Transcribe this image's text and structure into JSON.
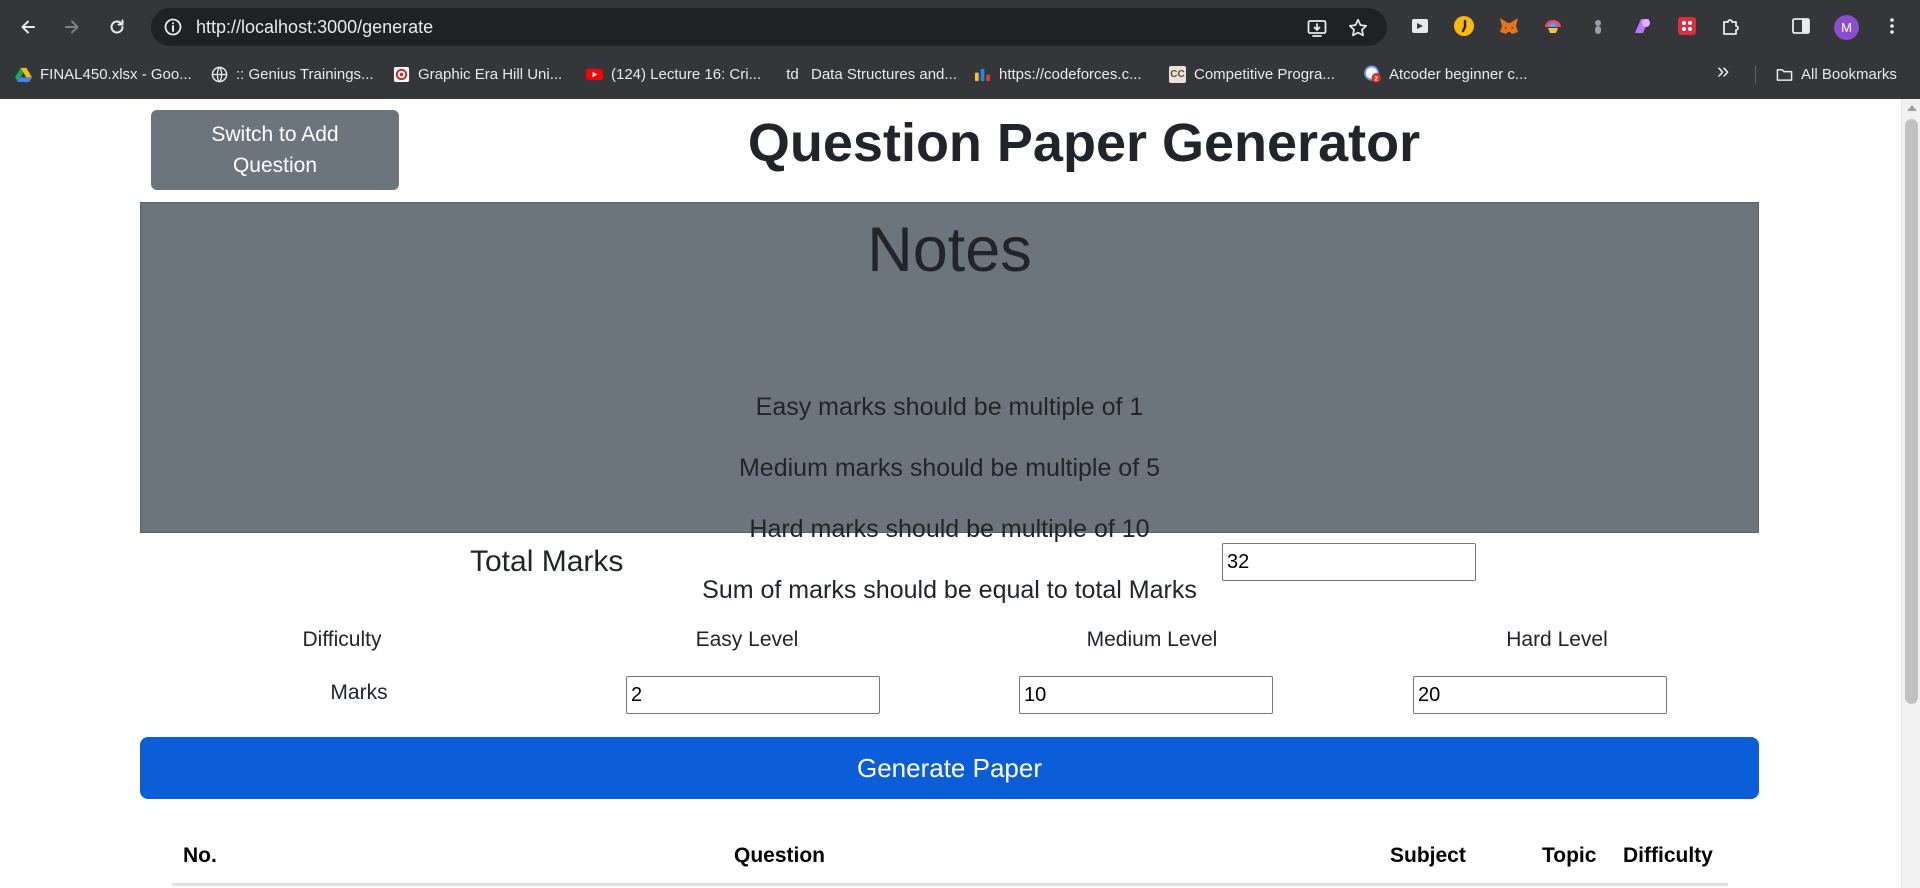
{
  "browser": {
    "url": "http://localhost:3000/generate",
    "avatar_letter": "M",
    "bookmarks": [
      {
        "label": "FINAL450.xlsx - Goo...",
        "icon": "google-drive-icon"
      },
      {
        "label": ":: Genius Trainings...",
        "icon": "globe-icon"
      },
      {
        "label": "Graphic Era Hill Uni...",
        "icon": "university-logo-icon"
      },
      {
        "label": "(124) Lecture 16: Cri...",
        "icon": "youtube-icon"
      },
      {
        "label": "Data Structures and...",
        "icon": "td-logo-icon",
        "icon_text": "td"
      },
      {
        "label": "https://codeforces.c...",
        "icon": "codeforces-icon"
      },
      {
        "label": "Competitive Progra...",
        "icon": "cc-logo-icon",
        "icon_text": "CC"
      },
      {
        "label": "Atcoder beginner c...",
        "icon": "atcoder-icon"
      }
    ],
    "all_bookmarks_label": "All Bookmarks",
    "overflow_label": "»"
  },
  "page": {
    "switch_button": "Switch to Add Question",
    "title": "Question Paper Generator",
    "notes": {
      "title": "Notes",
      "lines": [
        "Easy marks should be multiple of 1",
        "Medium marks should be multiple of 5",
        "Hard marks should be multiple of 10",
        "Sum of marks should be equal to total Marks"
      ]
    },
    "total_marks": {
      "label": "Total Marks",
      "value": "32"
    },
    "difficulty": {
      "row_label": "Difficulty",
      "marks_label": "Marks",
      "easy_label": "Easy Level",
      "medium_label": "Medium Level",
      "hard_label": "Hard Level",
      "easy_value": "2",
      "medium_value": "10",
      "hard_value": "20"
    },
    "generate_button": "Generate Paper",
    "table_headers": {
      "no": "No.",
      "question": "Question",
      "subject": "Subject",
      "topic": "Topic",
      "difficulty": "Difficulty"
    }
  },
  "colors": {
    "chrome_bg": "#35363a",
    "secondary": "#6c757d",
    "primary": "#0b5ed7"
  }
}
